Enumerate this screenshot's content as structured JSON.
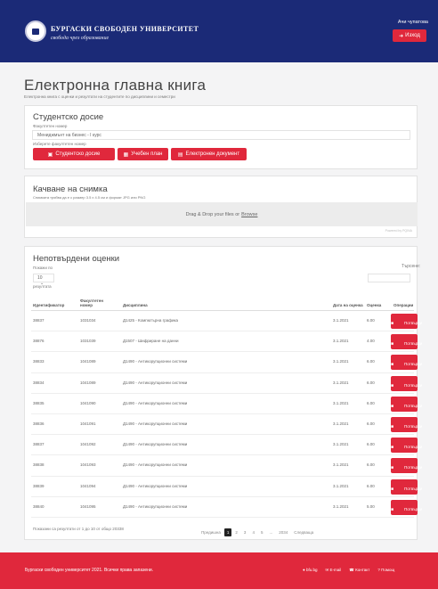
{
  "header": {
    "university_name": "БУРГАСКИ СВОБОДЕН УНИВЕРСИТЕТ",
    "motto": "свобода чрез образование",
    "user": "Ачи чупатова",
    "logout_icon": "sign-out-icon",
    "logout_label": "Изход"
  },
  "page": {
    "title": "Електронна главна книга",
    "subtitle": "Електронна книга с оценки и резултати на студентите по дисциплини и семестри"
  },
  "dossier": {
    "title": "Студентско досие",
    "select_label": "Факултетен номер",
    "select_value": "Мениджмънт на бизнес - I курс",
    "hint": "Изберете факултетен номер",
    "buttons": [
      {
        "icon": "vcard-icon",
        "label": "Студентско досие"
      },
      {
        "icon": "table-icon",
        "label": "Учебен план"
      },
      {
        "icon": "file-icon",
        "label": "Електронен документ"
      }
    ]
  },
  "upload": {
    "title": "Качване на снимка",
    "note": "Снимката трябва да е с размер 3.5 x 4.5 см и формат JPG или PNG",
    "drop_text": "Drag & Drop your files or",
    "browse_text": "Browse",
    "powered": "Powered by PQINA"
  },
  "grades": {
    "title": "Непотвърдени оценки",
    "perpage_label": "Покажи по",
    "perpage_value": "10",
    "perpage_suffix": "резултата",
    "search_label": "Търсене:",
    "columns": {
      "id": "Идентификатор",
      "faculty": "Факултетен номер",
      "discipline": "Дисциплина",
      "date": "Дата на оценка",
      "grade": "Оценка",
      "action": "Операции"
    },
    "action_icon": "trash-icon",
    "action_label": "Потвърди",
    "rows": [
      {
        "id": "38837",
        "faculty": "1031034",
        "discipline": "Д1425 - Компютърна графика",
        "date": "3.1.2021",
        "grade": "6.00"
      },
      {
        "id": "38876",
        "faculty": "1031039",
        "discipline": "Д1507 - Шифриране на данни",
        "date": "3.1.2021",
        "grade": "4.00"
      },
      {
        "id": "38833",
        "faculty": "1041089",
        "discipline": "Д1490 - Антикорупционни системи",
        "date": "3.1.2021",
        "grade": "6.00"
      },
      {
        "id": "38834",
        "faculty": "1041089",
        "discipline": "Д1490 - Антикорупционни системи",
        "date": "3.1.2021",
        "grade": "6.00"
      },
      {
        "id": "38835",
        "faculty": "1041090",
        "discipline": "Д1490 - Антикорупционни системи",
        "date": "3.1.2021",
        "grade": "6.00"
      },
      {
        "id": "38836",
        "faculty": "1041091",
        "discipline": "Д1490 - Антикорупционни системи",
        "date": "3.1.2021",
        "grade": "6.00"
      },
      {
        "id": "38837",
        "faculty": "1041092",
        "discipline": "Д1490 - Антикорупционни системи",
        "date": "3.1.2021",
        "grade": "6.00"
      },
      {
        "id": "38838",
        "faculty": "1041093",
        "discipline": "Д1490 - Антикорупционни системи",
        "date": "3.1.2021",
        "grade": "6.00"
      },
      {
        "id": "38839",
        "faculty": "1041094",
        "discipline": "Д1490 - Антикорупционни системи",
        "date": "3.1.2021",
        "grade": "6.00"
      },
      {
        "id": "38840",
        "faculty": "1041095",
        "discipline": "Д1490 - Антикорупционни системи",
        "date": "3.1.2021",
        "grade": "5.00"
      }
    ],
    "showing": "Показани са резултати от 1 до 10 от общо 20338",
    "pager": {
      "prev": "Предишна",
      "pages": [
        "1",
        "2",
        "3",
        "4",
        "5",
        "...",
        "2034"
      ],
      "next": "Следваща"
    }
  },
  "footer": {
    "copyright": "Бургаски свободен университет 2021. Всички права запазени.",
    "links": [
      {
        "icon": "globe-icon",
        "label": "bfu.bg"
      },
      {
        "icon": "envelope-icon",
        "label": "E-mail"
      },
      {
        "icon": "phone-icon",
        "label": "Контакт"
      },
      {
        "icon": "help-icon",
        "label": "Помощ"
      }
    ]
  }
}
